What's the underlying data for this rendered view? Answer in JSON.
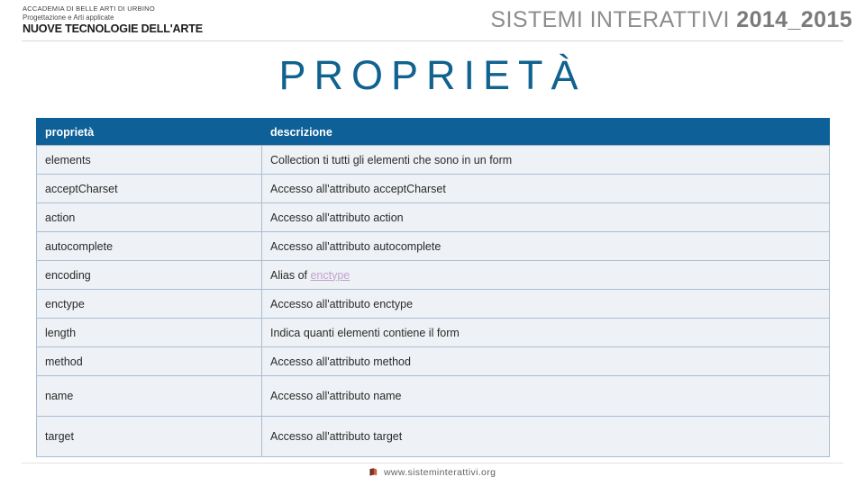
{
  "header": {
    "logo": {
      "line1": "ACCADEMIA DI BELLE ARTI DI URBINO",
      "line2": "Progettazione e Arti applicate",
      "line3": "NUOVE TECNOLOGIE DELL'ARTE"
    },
    "course_name": "SISTEMI INTERATTIVI",
    "course_year": "2014_2015"
  },
  "title": "PROPRIETÀ",
  "table": {
    "columns": [
      "proprietà",
      "descrizione"
    ],
    "rows": [
      {
        "property": "elements",
        "description": "Collection ti tutti gli elementi che sono in un form",
        "tall": false,
        "link": null
      },
      {
        "property": "acceptCharset",
        "description": "Accesso all'attributo acceptCharset",
        "tall": false,
        "link": null
      },
      {
        "property": "action",
        "description": "Accesso all'attributo action",
        "tall": false,
        "link": null
      },
      {
        "property": "autocomplete",
        "description": "Accesso all'attributo autocomplete",
        "tall": false,
        "link": null
      },
      {
        "property": "encoding",
        "description": "Alias of ",
        "tall": false,
        "link": "enctype"
      },
      {
        "property": "enctype",
        "description": "Accesso all'attributo enctype",
        "tall": false,
        "link": null
      },
      {
        "property": "length",
        "description": "Indica quanti elementi contiene il form",
        "tall": false,
        "link": null
      },
      {
        "property": "method",
        "description": "Accesso all'attributo method",
        "tall": false,
        "link": null
      },
      {
        "property": "name",
        "description": "Accesso all'attributo name",
        "tall": true,
        "link": null
      },
      {
        "property": "target",
        "description": "Accesso all'attributo target",
        "tall": true,
        "link": null
      }
    ]
  },
  "footer": {
    "icon": "book-icon",
    "url": "www.sisteminterattivi.org"
  },
  "colors": {
    "title_blue": "#10628f",
    "table_header_blue": "#0d6098",
    "row_background": "#eef1f5",
    "row_border": "#a9bdd2",
    "visited_link": "#c0a3cf"
  }
}
